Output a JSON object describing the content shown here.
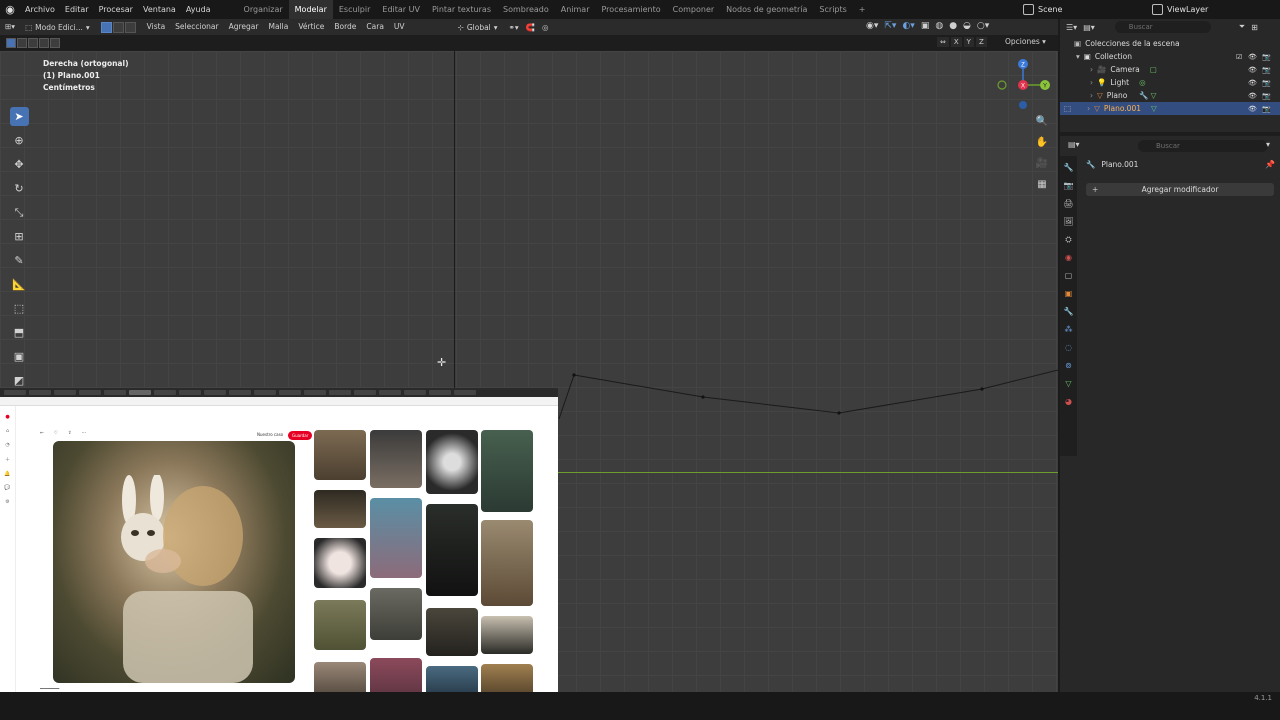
{
  "menu": {
    "items": [
      "Archivo",
      "Editar",
      "Procesar",
      "Ventana",
      "Ayuda"
    ]
  },
  "workspaces": {
    "tabs": [
      "Organizar",
      "Modelar",
      "Esculpir",
      "Editar UV",
      "Pintar texturas",
      "Sombreado",
      "Animar",
      "Procesamiento",
      "Componer",
      "Nodos de geometría",
      "Scripts"
    ],
    "active": "Modelar",
    "add": "+"
  },
  "scene": {
    "label": "Scene"
  },
  "view_layer": {
    "label": "ViewLayer"
  },
  "viewport_header": {
    "mode": "Modo Edici...",
    "menus": [
      "Vista",
      "Seleccionar",
      "Agregar",
      "Malla",
      "Vértice",
      "Borde",
      "Cara",
      "UV"
    ],
    "orientation": "Global"
  },
  "viewport_sub": {
    "axes": [
      "X",
      "Y",
      "Z"
    ],
    "options": "Opciones"
  },
  "viewport": {
    "view_name": "Derecha (ortogonal)",
    "object": "(1) Plano.001",
    "units": "Centímetros"
  },
  "gizmo": {
    "x": "X",
    "y": "Y",
    "z": "Z"
  },
  "outliner": {
    "search_placeholder": "Buscar",
    "title": "Colecciones de la escena",
    "collection": "Collection",
    "items": [
      "Camera",
      "Light",
      "Plano",
      "Plano.001"
    ],
    "selected": "Plano.001"
  },
  "properties": {
    "search_placeholder": "Buscar",
    "object_name": "Plano.001",
    "add_modifier": "Agregar modificador"
  },
  "browser": {
    "save_label": "Guardar",
    "profile_label": "Nuestro caso"
  },
  "status": {
    "version": "4.1.1"
  },
  "colors": {
    "accent": "#4772b3",
    "selected_row": "#334d80",
    "axis_y": "#6d9e2d",
    "pinterest": "#e60023"
  }
}
